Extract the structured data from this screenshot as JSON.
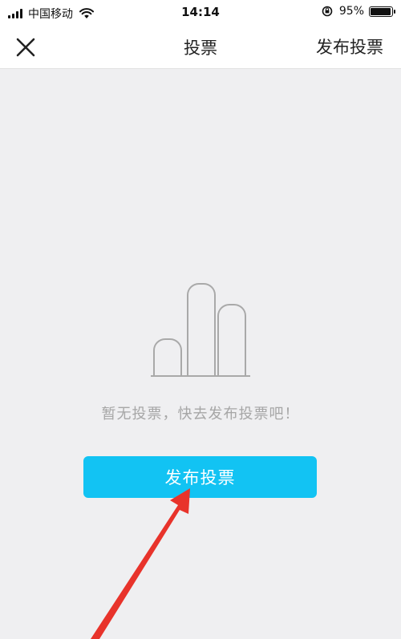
{
  "status_bar": {
    "carrier": "中国移动",
    "time": "14:14",
    "battery_text": "95%",
    "battery_level": 0.95,
    "icons": [
      "signal-icon",
      "wifi-icon",
      "rotation-lock-icon",
      "battery-icon"
    ]
  },
  "nav": {
    "close_icon": "close-icon",
    "title": "投票",
    "publish_label": "发布投票"
  },
  "empty_state": {
    "illustration_icon": "bar-chart-icon",
    "message": "暂无投票，快去发布投票吧！",
    "cta_label": "发布投票"
  },
  "annotation": {
    "arrow_icon": "red-arrow-icon",
    "color": "#e8332b"
  },
  "colors": {
    "accent": "#12c3f3",
    "background": "#efeff1",
    "muted_text": "#a6a6a6"
  }
}
